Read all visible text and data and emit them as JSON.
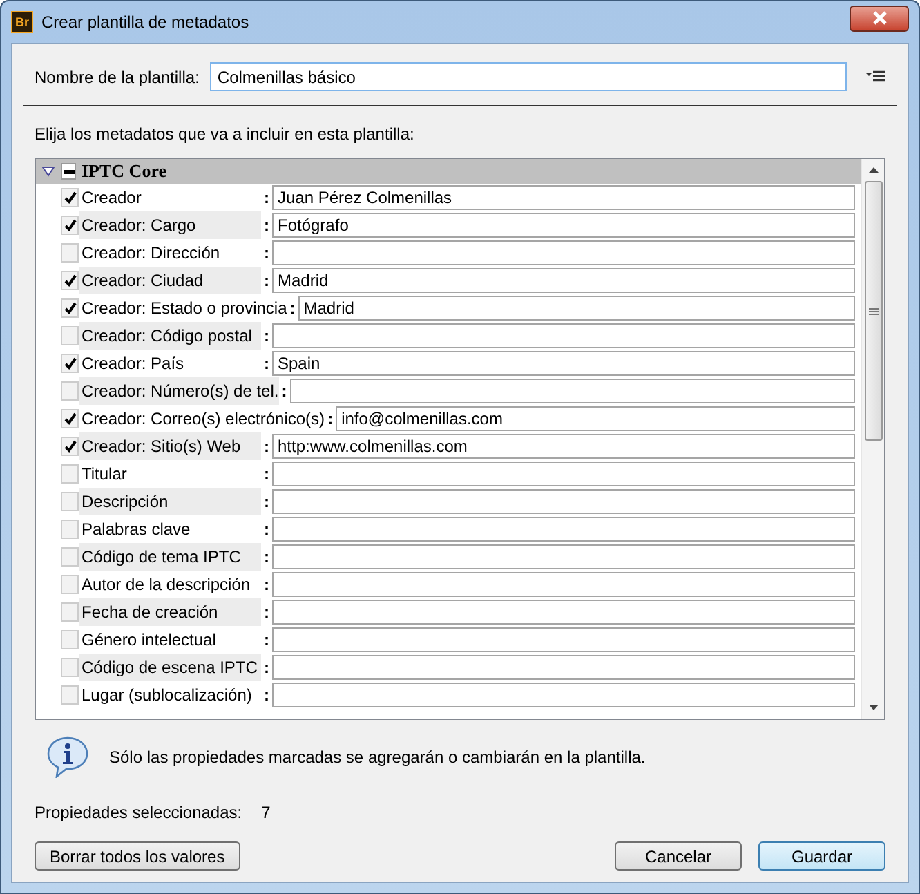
{
  "window": {
    "title": "Crear plantilla de metadatos",
    "app_logo": "Br"
  },
  "template_name": {
    "label": "Nombre de la plantilla:",
    "value": "Colmenillas básico"
  },
  "instruction": "Elija los metadatos que va a incluir en esta plantilla:",
  "group": {
    "title": "IPTC Core",
    "expanded": true,
    "indeterminate": true
  },
  "fields": [
    {
      "label": "Creador",
      "checked": true,
      "value": "Juan Pérez Colmenillas"
    },
    {
      "label": "Creador: Cargo",
      "checked": true,
      "value": "Fotógrafo"
    },
    {
      "label": "Creador: Dirección",
      "checked": false
    },
    {
      "label": "Creador: Ciudad",
      "checked": true,
      "value": "Madrid"
    },
    {
      "label": "Creador: Estado o provincia",
      "checked": true,
      "value": "Madrid"
    },
    {
      "label": "Creador: Código postal",
      "checked": false
    },
    {
      "label": "Creador: País",
      "checked": true,
      "value": "Spain"
    },
    {
      "label": "Creador: Número(s) de tel.",
      "checked": false
    },
    {
      "label": "Creador: Correo(s) electrónico(s)",
      "checked": true,
      "value": "info@colmenillas.com"
    },
    {
      "label": "Creador: Sitio(s) Web",
      "checked": true,
      "value": "http:www.colmenillas.com"
    },
    {
      "label": "Titular",
      "checked": false
    },
    {
      "label": "Descripción",
      "checked": false
    },
    {
      "label": "Palabras clave",
      "checked": false
    },
    {
      "label": "Código de tema IPTC",
      "checked": false
    },
    {
      "label": "Autor de la descripción",
      "checked": false
    },
    {
      "label": "Fecha de creación",
      "checked": false
    },
    {
      "label": "Género intelectual",
      "checked": false
    },
    {
      "label": "Código de escena IPTC",
      "checked": false
    },
    {
      "label": "Lugar (sublocalización)",
      "checked": false
    }
  ],
  "separator": ":",
  "info": "Sólo las propiedades marcadas se agregarán o cambiarán en la plantilla.",
  "selected_count": {
    "label": "Propiedades seleccionadas:",
    "value": "7"
  },
  "buttons": {
    "clear": "Borrar todos los valores",
    "cancel": "Cancelar",
    "save": "Guardar"
  }
}
